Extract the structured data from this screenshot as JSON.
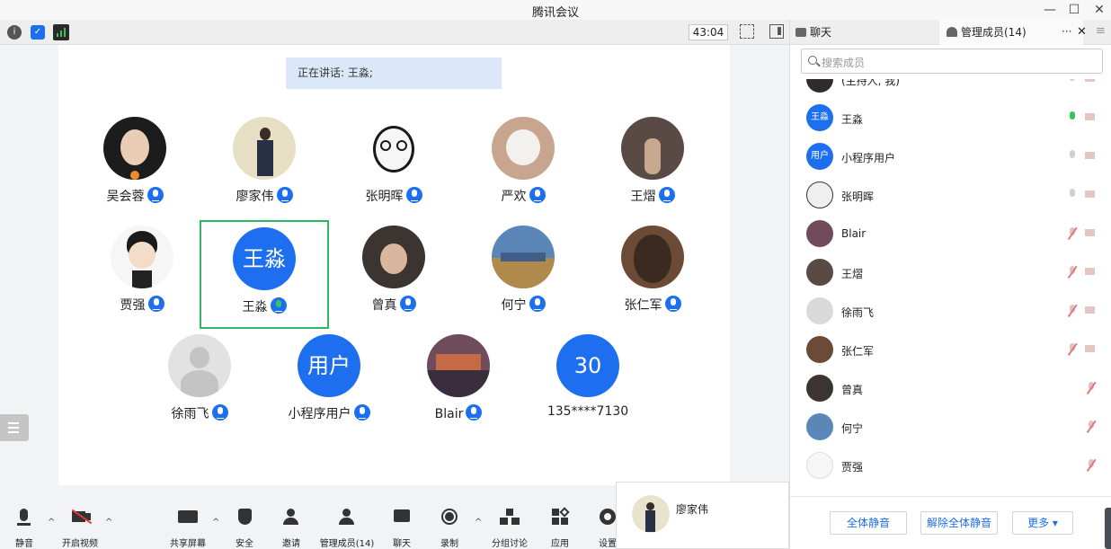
{
  "window": {
    "title": "腾讯会议",
    "minimize": "—",
    "maximize": "☐",
    "close": "✕"
  },
  "topbar": {
    "timer": "43:04"
  },
  "speaking": {
    "text": "正在讲话: 王淼;"
  },
  "tiles": [
    {
      "name": "吴会蓉",
      "initials": "",
      "color": "#1c1c1c"
    },
    {
      "name": "廖家伟",
      "initials": "",
      "color": "#e7dfc4"
    },
    {
      "name": "张明晖",
      "initials": "",
      "color": "#f4f4f4"
    },
    {
      "name": "严欢",
      "initials": "",
      "color": "#c7a58f"
    },
    {
      "name": "王熠",
      "initials": "",
      "color": "#5a4a46"
    },
    {
      "name": "贾强",
      "initials": "",
      "color": "#f6f6f6"
    },
    {
      "name": "王淼",
      "initials": "王淼",
      "color": "#1e6ff0"
    },
    {
      "name": "曾真",
      "initials": "",
      "color": "#3b3430"
    },
    {
      "name": "何宁",
      "initials": "",
      "color": "#5a87b8"
    },
    {
      "name": "张仁军",
      "initials": "",
      "color": "#6b4a36"
    },
    {
      "name": "徐雨飞",
      "initials": "",
      "color": "#d9d9d9"
    },
    {
      "name": "小程序用户",
      "initials": "用户",
      "color": "#1e6ff0"
    },
    {
      "name": "Blair",
      "initials": "",
      "color": "#6f4b5c"
    },
    {
      "name": "135****7130",
      "initials": "30",
      "color": "#1e6ff0"
    }
  ],
  "panel": {
    "chat_tab": "聊天",
    "members_tab": "管理成员(14)",
    "more": "···",
    "close": "✕",
    "menu": "≡",
    "search_placeholder": "搜索成员",
    "members": [
      {
        "name": "(主持人, 我)",
        "initials": "",
        "color": "#2e2b2a"
      },
      {
        "name": "王淼",
        "initials": "王淼",
        "color": "#1e6ff0"
      },
      {
        "name": "小程序用户",
        "initials": "用户",
        "color": "#1e6ff0"
      },
      {
        "name": "张明晖",
        "initials": "",
        "color": "#efefef"
      },
      {
        "name": "Blair",
        "initials": "",
        "color": "#6f4b5c"
      },
      {
        "name": "王熠",
        "initials": "",
        "color": "#5a4a46"
      },
      {
        "name": "徐雨飞",
        "initials": "",
        "color": "#d9d9d9"
      },
      {
        "name": "张仁军",
        "initials": "",
        "color": "#6b4a36"
      },
      {
        "name": "曾真",
        "initials": "",
        "color": "#3b3430"
      },
      {
        "name": "何宁",
        "initials": "",
        "color": "#5a87b8"
      },
      {
        "name": "贾强",
        "initials": "",
        "color": "#f6f6f6"
      }
    ],
    "mute_all": "全体静音",
    "unmute_all": "解除全体静音",
    "more_btn": "更多 ▾"
  },
  "toolbar": {
    "mute": "静音",
    "video": "开启视频",
    "share": "共享屏幕",
    "security": "安全",
    "invite": "邀请",
    "manage": "管理成员(14)",
    "chat": "聊天",
    "record": "录制",
    "breakout": "分组讨论",
    "apps": "应用",
    "settings": "设置"
  },
  "popup": {
    "name": "廖家伟"
  },
  "colors": {
    "accent": "#1e6ff0",
    "speaking_bg": "#dbe8fa",
    "active_border": "#2fb864"
  }
}
